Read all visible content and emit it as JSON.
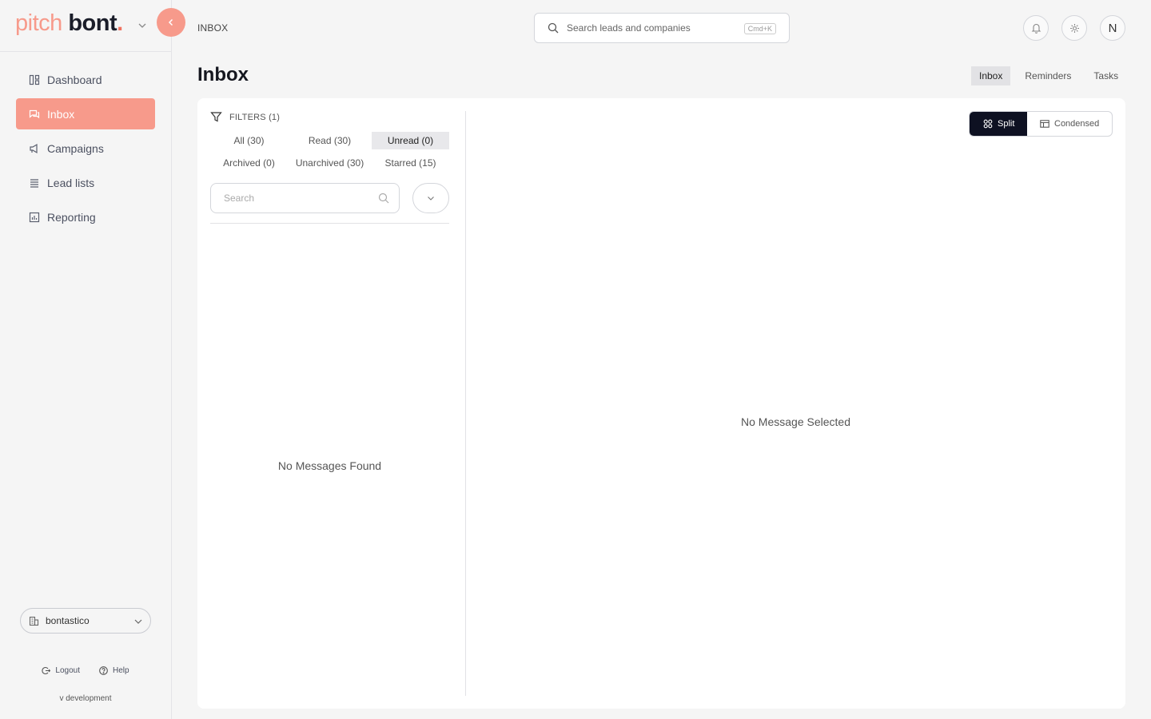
{
  "brand": {
    "part1": "pitch",
    "part2": "bont",
    "dot": ".",
    "accent": "#f79a8b",
    "dark": "#1a1d29"
  },
  "sidebar": {
    "items": [
      {
        "label": "Dashboard",
        "icon": "dashboard-icon",
        "active": false
      },
      {
        "label": "Inbox",
        "icon": "chat-icon",
        "active": true
      },
      {
        "label": "Campaigns",
        "icon": "megaphone-icon",
        "active": false
      },
      {
        "label": "Lead lists",
        "icon": "list-icon",
        "active": false
      },
      {
        "label": "Reporting",
        "icon": "chart-icon",
        "active": false
      }
    ],
    "workspace": "bontastico",
    "logout": "Logout",
    "help": "Help",
    "version": "v development"
  },
  "header": {
    "breadcrumb": "INBOX",
    "search_placeholder": "Search leads and companies",
    "shortcut": "Cmd+K",
    "avatar": "N"
  },
  "page": {
    "title": "Inbox",
    "tabs": [
      {
        "label": "Inbox",
        "active": true
      },
      {
        "label": "Reminders",
        "active": false
      },
      {
        "label": "Tasks",
        "active": false
      }
    ]
  },
  "list": {
    "filters_label": "FILTERS (1)",
    "segments": [
      {
        "label": "All (30)",
        "active": false
      },
      {
        "label": "Read (30)",
        "active": false
      },
      {
        "label": "Unread (0)",
        "active": true
      },
      {
        "label": "Archived (0)",
        "active": false
      },
      {
        "label": "Unarchived (30)",
        "active": false
      },
      {
        "label": "Starred (15)",
        "active": false
      }
    ],
    "search_placeholder": "Search",
    "empty": "No Messages Found"
  },
  "detail": {
    "view_split": "Split",
    "view_condensed": "Condensed",
    "empty": "No Message Selected"
  }
}
